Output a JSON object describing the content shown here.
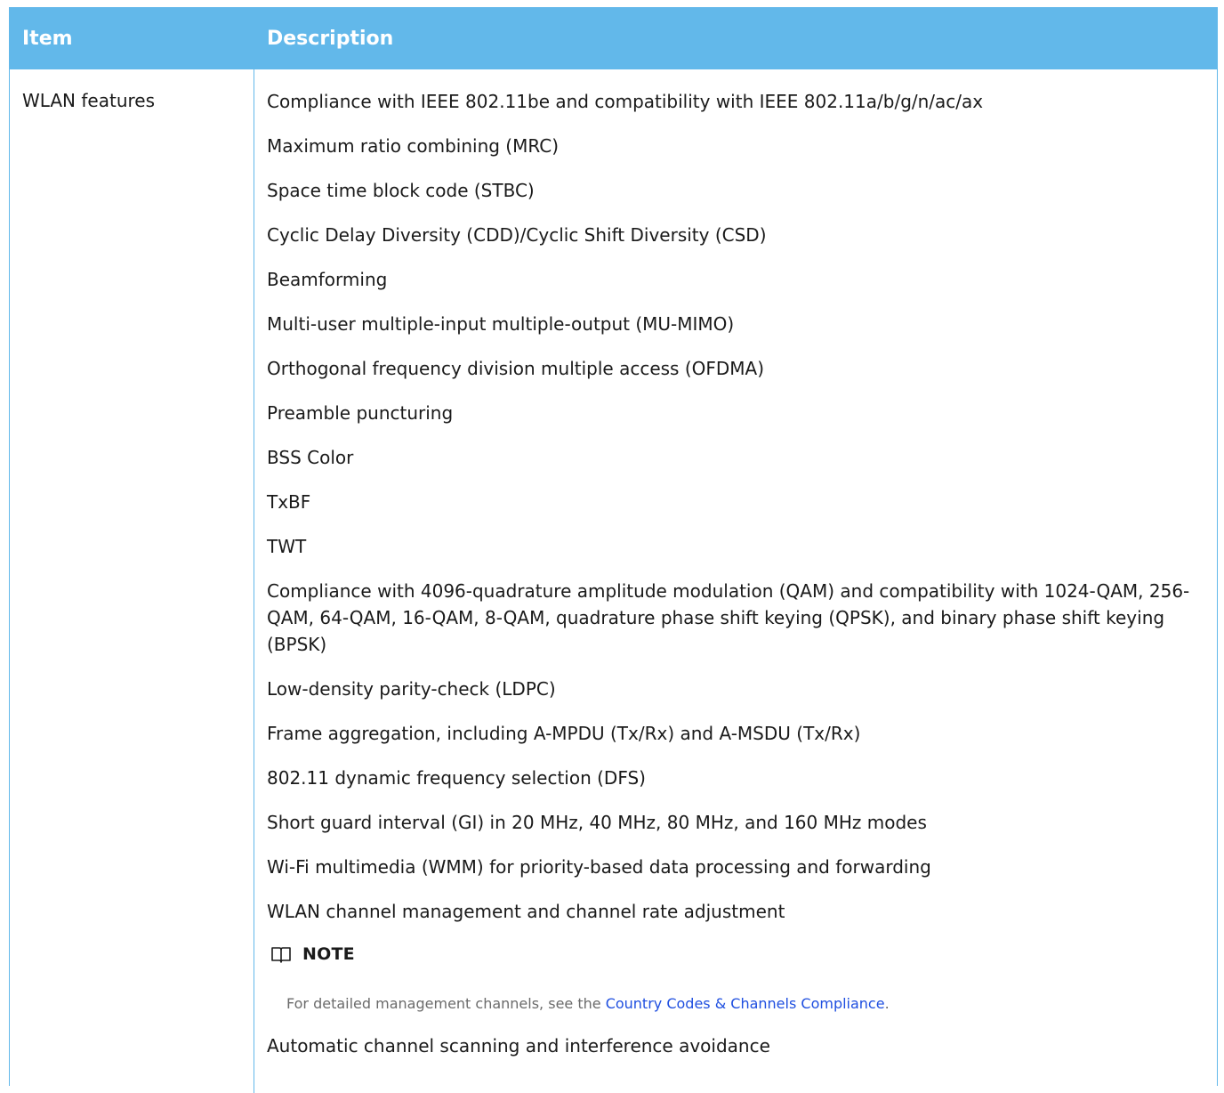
{
  "table": {
    "headers": {
      "item": "Item",
      "description": "Description"
    },
    "row": {
      "item": "WLAN features",
      "features": [
        "Compliance with IEEE 802.11be and compatibility with IEEE 802.11a/b/g/n/ac/ax",
        "Maximum ratio combining (MRC)",
        "Space time block code (STBC)",
        "Cyclic Delay Diversity (CDD)/Cyclic Shift Diversity (CSD)",
        "Beamforming",
        "Multi-user multiple-input multiple-output (MU-MIMO)",
        "Orthogonal frequency division multiple access (OFDMA)",
        "Preamble puncturing",
        "BSS Color",
        "TxBF",
        "TWT",
        "Compliance with 4096-quadrature amplitude modulation (QAM) and compatibility with 1024-QAM, 256-QAM, 64-QAM, 16-QAM, 8-QAM, quadrature phase shift keying (QPSK), and binary phase shift keying (BPSK)",
        "Low-density parity-check (LDPC)",
        "Frame aggregation, including A-MPDU (Tx/Rx) and A-MSDU (Tx/Rx)",
        "802.11 dynamic frequency selection (DFS)",
        "Short guard interval (GI) in 20 MHz, 40 MHz, 80 MHz, and 160 MHz modes",
        "Wi-Fi multimedia (WMM) for priority-based data processing and forwarding",
        "WLAN channel management and channel rate adjustment"
      ],
      "note": {
        "icon": "book-icon",
        "title": "NOTE",
        "text_before": "For detailed management channels, see the ",
        "link": "Country Codes & Channels Compliance",
        "text_after": "."
      },
      "after_note": [
        "Automatic channel scanning and interference avoidance"
      ]
    }
  },
  "colors": {
    "header_bg": "#62b8ea",
    "header_text": "#ffffff",
    "link": "#1f4fe0",
    "note_text": "#6b6b6b"
  }
}
